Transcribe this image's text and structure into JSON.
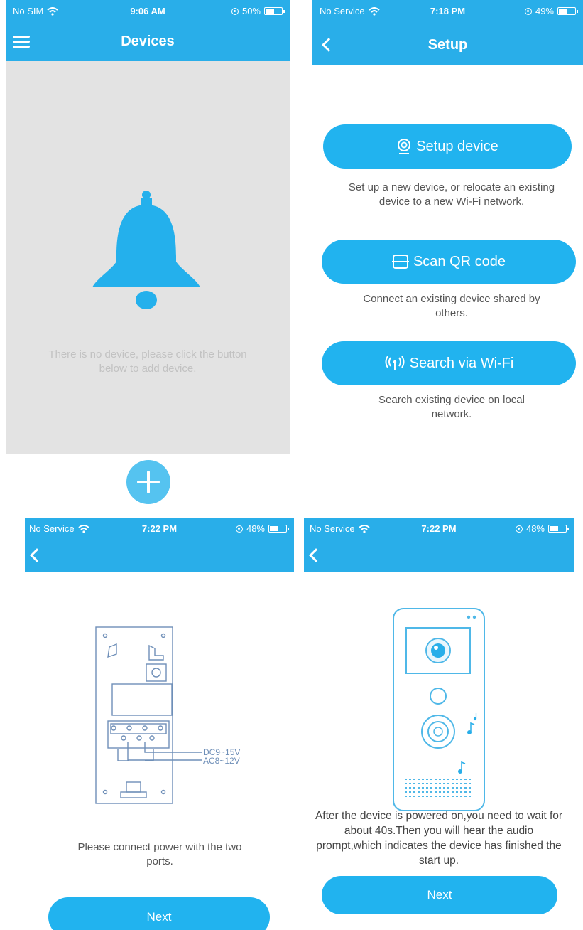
{
  "screen1": {
    "status": {
      "carrier": "No SIM",
      "time": "9:06 AM",
      "battery": "50%"
    },
    "title": "Devices",
    "empty_message": "There is no device, please click the button below to add device.",
    "icons": {
      "menu": "menu-icon",
      "bell": "bell-icon",
      "add": "plus-icon"
    }
  },
  "screen2": {
    "status": {
      "carrier": "No Service",
      "time": "7:18 PM",
      "battery": "49%"
    },
    "title": "Setup",
    "options": [
      {
        "label": "Setup device",
        "icon": "camera-icon",
        "description": "Set up a new device, or relocate an existing device to a new Wi-Fi network."
      },
      {
        "label": "Scan QR code",
        "icon": "qr-scan-icon",
        "description": "Connect an existing device shared by others."
      },
      {
        "label": "Search via Wi-Fi",
        "icon": "wifi-signal-icon",
        "description": "Search existing device on local network."
      }
    ]
  },
  "screen3": {
    "status": {
      "carrier": "No Service",
      "time": "7:22 PM",
      "battery": "48%"
    },
    "port_labels": {
      "dc": "DC9~15V",
      "ac": "AC8~12V"
    },
    "instruction": "Please connect power with the two ports.",
    "next_label": "Next"
  },
  "screen4": {
    "status": {
      "carrier": "No Service",
      "time": "7:22 PM",
      "battery": "48%"
    },
    "instruction": "After the device is powered on,you need to wait for about 40s.Then you will hear the audio prompt,which indicates the device has finished the start up.",
    "next_label": "Next"
  },
  "colors": {
    "accent": "#29aee9",
    "button": "#21b3ef",
    "empty_bg": "#e3e3e3",
    "muted_text": "#c2c2c2"
  }
}
